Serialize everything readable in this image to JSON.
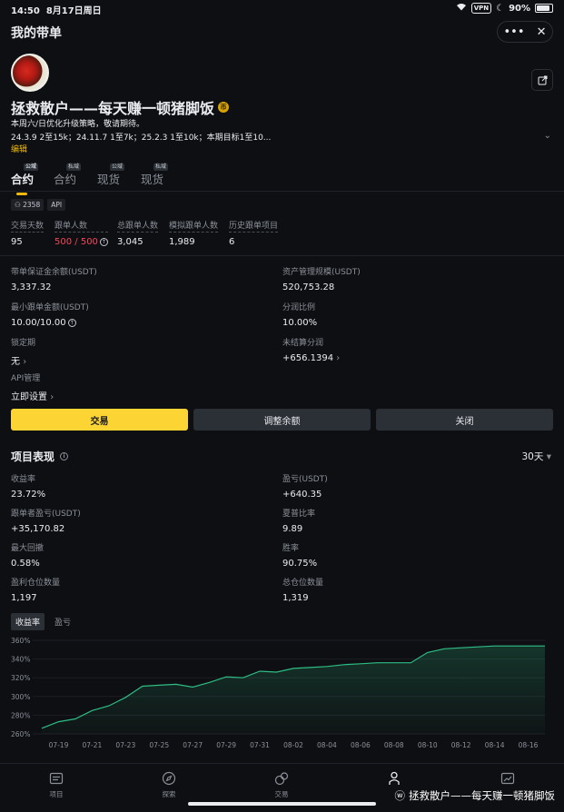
{
  "status_bar": {
    "time": "14:50",
    "date": "8月17日周日",
    "vpn": "VPN",
    "battery": "90%"
  },
  "header": {
    "title": "我的带单"
  },
  "trader": {
    "name": "拯救散户——每天赚一顿猪脚饭",
    "badge_text": "帀",
    "desc_line1": "本周六/日优化升级策略，敬请期待。",
    "desc_line2": "24.3.9  2至15k；24.11.7  1至7k；25.2.3  1至10k；本期目标1至10...",
    "edit_label": "编辑"
  },
  "tabs": [
    {
      "label": "合约",
      "tag": "公域"
    },
    {
      "label": "合约",
      "tag": "私域"
    },
    {
      "label": "现货",
      "tag": "公域"
    },
    {
      "label": "现货",
      "tag": "私域"
    }
  ],
  "chips": {
    "followers_count": "2358",
    "api_label": "API"
  },
  "stats": [
    {
      "label": "交易天数",
      "value": "95"
    },
    {
      "label": "跟单人数",
      "value_current": "500",
      "value_sep": " / ",
      "value_max": "500"
    },
    {
      "label": "总跟单人数",
      "value": "3,045"
    },
    {
      "label": "模拟跟单人数",
      "value": "1,989"
    },
    {
      "label": "历史跟单项目",
      "value": "6"
    }
  ],
  "details": {
    "margin_balance_label": "带单保证金余额(USDT)",
    "margin_balance_value": "3,337.32",
    "aum_label": "资产管理规模(USDT)",
    "aum_value": "520,753.28",
    "min_copy_label": "最小跟单金额(USDT)",
    "min_copy_value": "10.00/10.00",
    "profit_share_label": "分润比例",
    "profit_share_value": "10.00%",
    "lock_label": "锁定期",
    "lock_value": "无",
    "unsettled_label": "未结算分润",
    "unsettled_value": "+656.1394",
    "api_mgmt_label": "API管理",
    "api_mgmt_value": "立即设置"
  },
  "buttons": {
    "trade": "交易",
    "adjust": "调整余额",
    "close": "关闭"
  },
  "performance": {
    "title": "项目表现",
    "period": "30天",
    "metrics": [
      {
        "label": "收益率",
        "value": "23.72%",
        "color": "green"
      },
      {
        "label": "盈亏(USDT)",
        "value": "+640.35",
        "color": "green"
      },
      {
        "label": "跟单者盈亏(USDT)",
        "value": "+35,170.82",
        "color": "green"
      },
      {
        "label": "夏普比率",
        "value": "9.89",
        "color": "white"
      },
      {
        "label": "最大回撤",
        "value": "0.58%",
        "color": "white"
      },
      {
        "label": "胜率",
        "value": "90.75%",
        "color": "white"
      },
      {
        "label": "盈利仓位数量",
        "value": "1,197",
        "color": "white"
      },
      {
        "label": "总仓位数量",
        "value": "1,319",
        "color": "white"
      }
    ],
    "chart_tabs": [
      "收益率",
      "盈亏"
    ]
  },
  "chart_data": {
    "type": "area",
    "y_ticks": [
      "360%",
      "340%",
      "320%",
      "300%",
      "280%",
      "260%"
    ],
    "x_ticks": [
      "07-19",
      "07-21",
      "07-23",
      "07-25",
      "07-27",
      "07-29",
      "07-31",
      "08-02",
      "08-04",
      "08-06",
      "08-08",
      "08-10",
      "08-12",
      "08-14",
      "08-16"
    ],
    "ylim": [
      260,
      360
    ],
    "x": [
      "07-18",
      "07-19",
      "07-20",
      "07-21",
      "07-22",
      "07-23",
      "07-24",
      "07-25",
      "07-26",
      "07-27",
      "07-28",
      "07-29",
      "07-30",
      "07-31",
      "08-01",
      "08-02",
      "08-03",
      "08-04",
      "08-05",
      "08-06",
      "08-07",
      "08-08",
      "08-09",
      "08-10",
      "08-11",
      "08-12",
      "08-13",
      "08-14",
      "08-15",
      "08-16",
      "08-17"
    ],
    "values": [
      266,
      273,
      276,
      285,
      290,
      299,
      311,
      312,
      313,
      310,
      315,
      321,
      320,
      327,
      326,
      330,
      331,
      332,
      334,
      335,
      336,
      336,
      336,
      347,
      351,
      352,
      353,
      354,
      354,
      354,
      354
    ],
    "line_color": "#2ebd85",
    "grid": true
  },
  "bottom_nav": [
    {
      "label": "项目",
      "icon": "project-icon"
    },
    {
      "label": "探索",
      "icon": "compass-icon"
    },
    {
      "label": "交易",
      "icon": "trade-icon"
    },
    {
      "label": "",
      "icon": "person-icon"
    },
    {
      "label": "",
      "icon": "chart-icon"
    }
  ],
  "watermark": "拯救散户——每天赚一顿猪脚饭"
}
